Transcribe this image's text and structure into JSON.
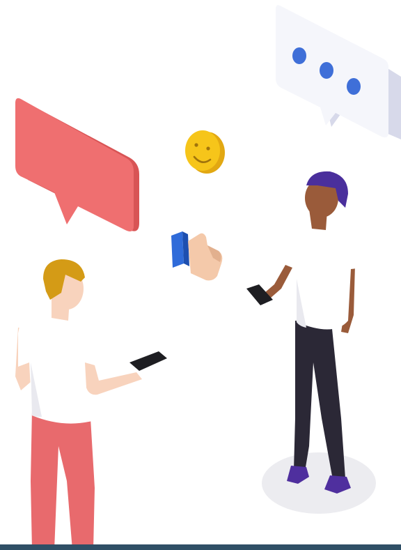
{
  "colors": {
    "background": "#ffffff",
    "red_bubble": "#ef6f70",
    "red_bubble_side": "#d85455",
    "white_bubble": "#f5f6fb",
    "white_bubble_side": "#d7d9ea",
    "dots": "#3f6fd8",
    "emoji_face": "#f6c51a",
    "emoji_side": "#e2a812",
    "thumb_skin": "#f4c9aa",
    "thumb_cuff": "#2f6bd9",
    "shirt": "#ffffff",
    "shirt_shadow": "#e9e9ef",
    "left_pants": "#e86a6d",
    "left_hair": "#d49b16",
    "left_skin": "#f8d3bd",
    "right_skin": "#9a5b3a",
    "right_hair": "#4a2f9c",
    "right_pants": "#2b2836",
    "right_shoes": "#4f2f9e",
    "phone": "#1e1e22",
    "floor_shadow": "#ececf0",
    "bottom_bar": "#2f4f66"
  },
  "icons": {
    "chat_bubble_red": "speech-bubble",
    "chat_bubble_typing": "typing-bubble",
    "emoji": "smiley-face",
    "like": "thumbs-up"
  }
}
